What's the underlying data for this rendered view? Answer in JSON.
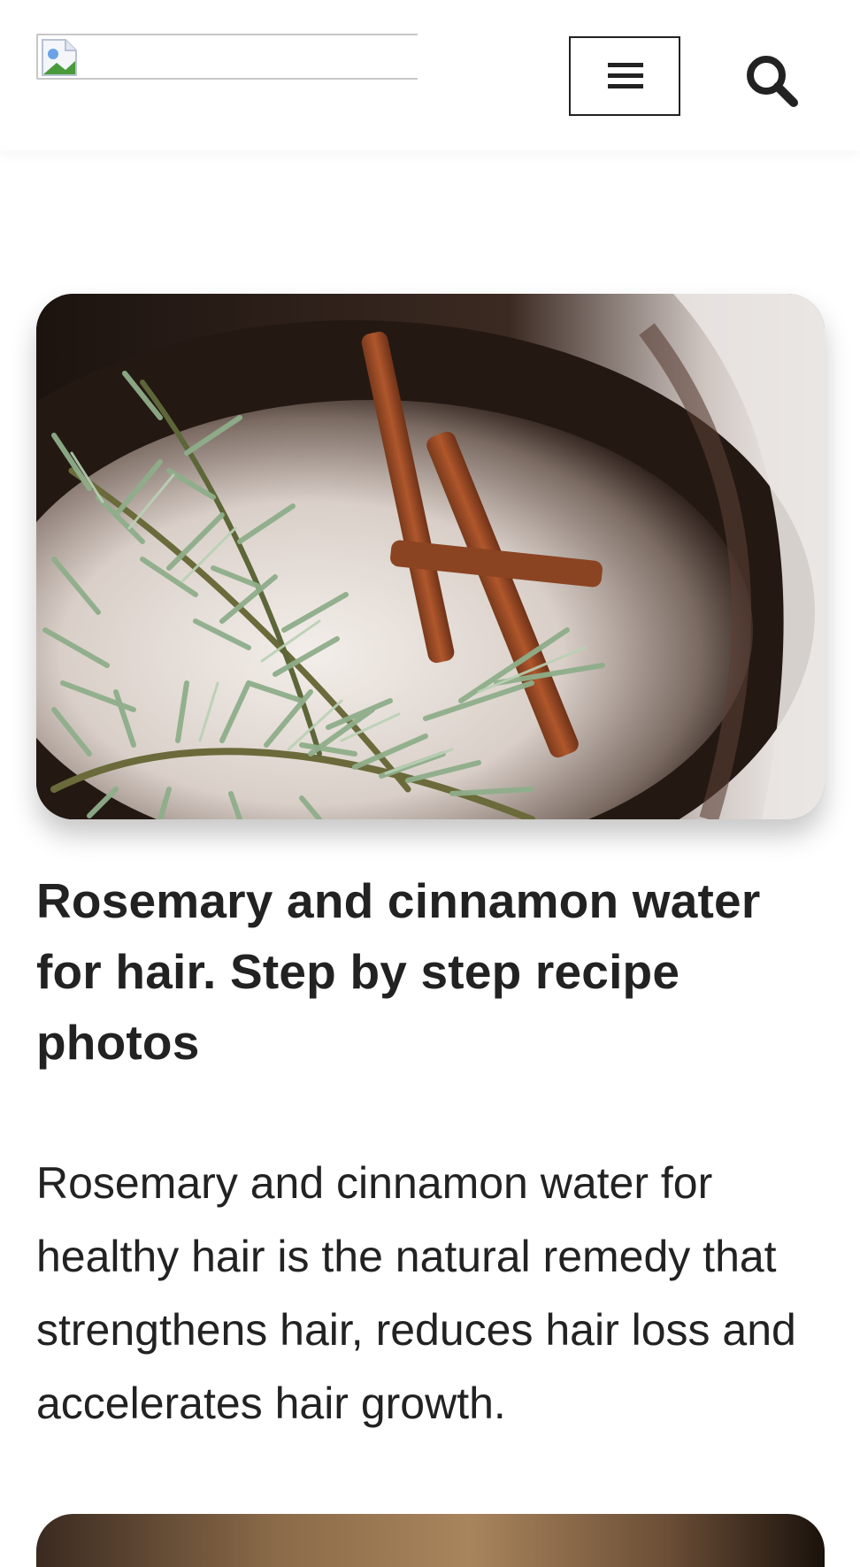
{
  "header": {
    "logo_alt": "",
    "menu_button": "menu-icon",
    "search_button": "search-icon"
  },
  "article": {
    "image_alt": "Rosemary and cinnamon water for hair",
    "title": "Rosemary and cinnamon water for hair. Step by step recipe photos",
    "excerpt": "Rosemary and cinnamon water for healthy hair is the natural remedy that strengthens hair, reduces hair loss and accelerates hair growth."
  },
  "colors": {
    "text": "#222222",
    "border": "#222222",
    "background": "#ffffff"
  }
}
